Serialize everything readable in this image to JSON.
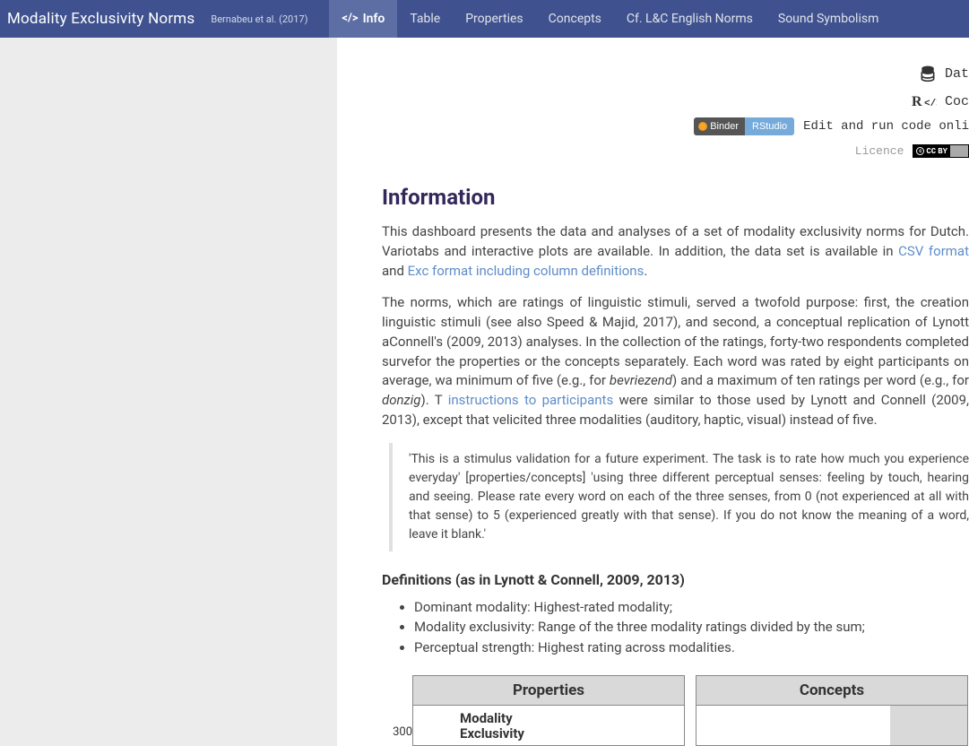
{
  "navbar": {
    "title": "Modality Exclusivity Norms",
    "subtitle": "Bernabeu et al. (2017)",
    "tabs": [
      {
        "label": "Info",
        "icon": "code-icon",
        "active": true
      },
      {
        "label": "Table"
      },
      {
        "label": "Properties"
      },
      {
        "label": "Concepts"
      },
      {
        "label": "Cf. L&C English Norms"
      },
      {
        "label": "Sound Symbolism"
      }
    ]
  },
  "top_links": {
    "data_label_partial": "Dat",
    "code_label_partial": "Coc",
    "binder_left": "Binder",
    "binder_right": "RStudio",
    "binder_text_partial": "Edit and run code onli",
    "licence_label": "Licence",
    "cc_text": "CC",
    "by_text": "BY"
  },
  "info": {
    "heading": "Information",
    "p1_a": "This dashboard presents the data and analyses of a set of modality exclusivity norms for Dutch. Vario",
    "p1_b": "tabs and interactive plots are available. In addition, the data set is available in ",
    "p1_link1": "CSV format",
    "p1_c": " and ",
    "p1_link2_partial": "Exc",
    "p1_link3": "format including column definitions",
    "p1_d": ".",
    "p2_a": "The norms, which are ratings of linguistic stimuli, served a twofold purpose: first, the creation ",
    "p2_b": "linguistic stimuli (see also Speed & Majid, 2017), and second, a conceptual replication of Lynott a",
    "p2_c": "Connell's (2009, 2013) analyses. In the collection of the ratings, forty-two respondents completed surve",
    "p2_d": "for the properties or the concepts separately. Each word was rated by eight participants on average, w",
    "p2_e": "a minimum of five (e.g., for ",
    "p2_em1": "bevriezend",
    "p2_f": ") and a maximum of ten ratings per word (e.g., for ",
    "p2_em2": "donzig",
    "p2_g": "). T",
    "p2_link": "instructions to participants",
    "p2_h": " were similar to those used by Lynott and Connell (2009, 2013), except that v",
    "p2_i": "elicited three modalities (auditory, haptic, visual) instead of five.",
    "quote": "'This is a stimulus validation for a future experiment. The task is to rate how much you experience everyday' [properties/concepts] 'using three different perceptual senses: feeling by touch, hearing and seeing. Please rate every word on each of the three senses, from 0 (not experienced at all with that sense) to 5 (experienced greatly with that sense). If you do not know the meaning of a word, leave it blank.'",
    "defs_heading": "Definitions (as in Lynott & Connell, 2009, 2013)",
    "defs": [
      "Dominant modality: Highest-rated modality;",
      "Modality exclusivity: Range of the three modality ratings divided by the sum;",
      "Perceptual strength: Highest rating across modalities."
    ]
  },
  "chart_data": {
    "type": "bar",
    "facets": [
      "Properties",
      "Concepts"
    ],
    "legend_label_line1": "Modality",
    "legend_label_line2": "Exclusivity",
    "y_tick_visible": "300",
    "ylim": [
      0,
      300
    ]
  }
}
